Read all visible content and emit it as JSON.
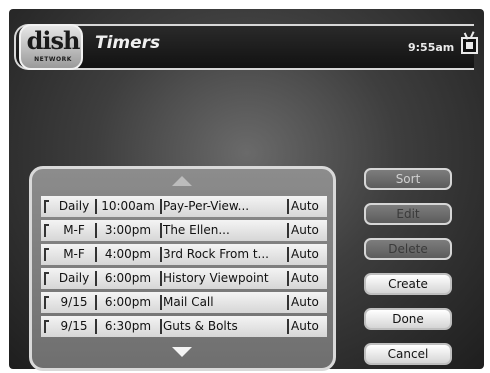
{
  "header": {
    "logo_word": "dish",
    "logo_sub": "NETWORK",
    "title": "Timers",
    "clock": "9:55am"
  },
  "timers": [
    {
      "frequency": "Daily",
      "time": "10:00am",
      "program": "Pay-Per-View...",
      "type": "Auto"
    },
    {
      "frequency": "M-F",
      "time": "3:00pm",
      "program": "The Ellen...",
      "type": "Auto"
    },
    {
      "frequency": "M-F",
      "time": "4:00pm",
      "program": "3rd Rock From t...",
      "type": "Auto"
    },
    {
      "frequency": "Daily",
      "time": "6:00pm",
      "program": "History Viewpoint",
      "type": "Auto"
    },
    {
      "frequency": "9/15",
      "time": "6:00pm",
      "program": "Mail Call",
      "type": "Auto"
    },
    {
      "frequency": "9/15",
      "time": "6:30pm",
      "program": "Guts & Bolts",
      "type": "Auto"
    }
  ],
  "buttons": {
    "sort": "Sort",
    "edit": "Edit",
    "delete": "Delete",
    "create": "Create",
    "done": "Done",
    "cancel": "Cancel"
  },
  "icons": {
    "scroll_up": "triangle-up-icon",
    "scroll_down": "triangle-down-icon",
    "tv": "tv-icon"
  }
}
